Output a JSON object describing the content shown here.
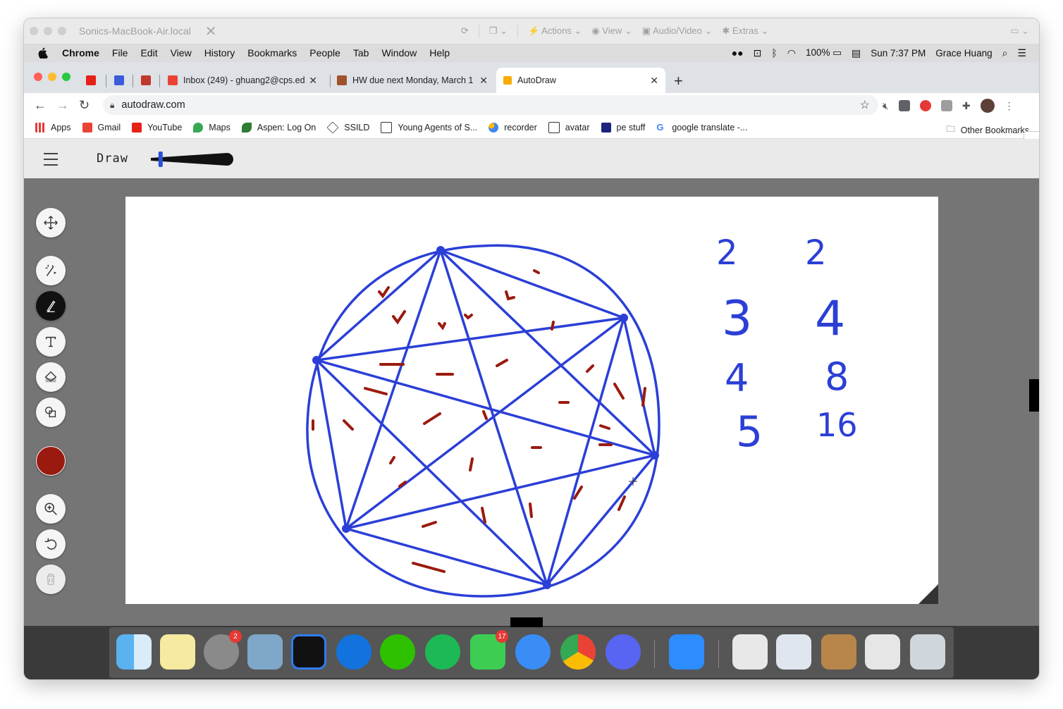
{
  "remote_bar": {
    "title": "Sonics-MacBook-Air.local",
    "actions": "Actions",
    "view": "View",
    "audio_video": "Audio/Video",
    "extras": "Extras"
  },
  "menubar": {
    "items": [
      "Chrome",
      "File",
      "Edit",
      "View",
      "History",
      "Bookmarks",
      "People",
      "Tab",
      "Window",
      "Help"
    ],
    "battery": "100%",
    "clock": "Sun 7:37 PM",
    "user": "Grace Huang"
  },
  "tabs": [
    {
      "title": "Inbox (249) - ghuang2@cps.ed"
    },
    {
      "title": "HW due next Monday, March 1"
    },
    {
      "title": "AutoDraw"
    }
  ],
  "address": {
    "url": "autodraw.com"
  },
  "bookmarks": {
    "items": [
      "Apps",
      "Gmail",
      "YouTube",
      "Maps",
      "Aspen: Log On",
      "SSILD",
      "Young Agents of S...",
      "recorder",
      "avatar",
      "pe stuff",
      "google translate -..."
    ],
    "other": "Other Bookmarks"
  },
  "autodraw": {
    "mode": "Draw",
    "selected_tool": "draw",
    "brush_color": "#9a1a0f",
    "stroke_color": "#2b3fd6",
    "brush_size": 0.1
  },
  "canvas_text": {
    "col1": [
      "2",
      "3",
      "4",
      "5"
    ],
    "col2": [
      "2",
      "4",
      "8",
      "16"
    ]
  },
  "dock": {
    "badges": {
      "system_prefs": "2",
      "facetime": "17"
    }
  },
  "colors": {
    "accent_blue": "#1a73e8",
    "stage_gray": "#757575"
  }
}
